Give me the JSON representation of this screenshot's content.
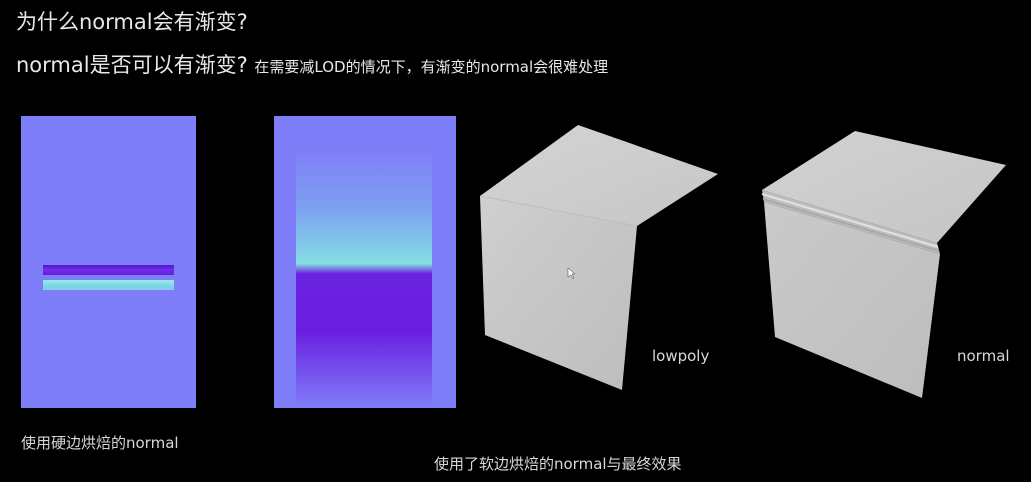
{
  "title_line1": "为什么normal会有渐变?",
  "title_line2_main": "normal是否可以有渐变?",
  "title_line2_sub": "在需要减LOD的情况下，有渐变的normal会很难处理",
  "caption_hard_edge": "使用硬边烘焙的normal",
  "caption_soft_edge": "使用了软边烘焙的normal与最终效果",
  "label_lowpoly": "lowpoly",
  "label_normal": "normal",
  "colors": {
    "normal_map_base": "#7f7ef9",
    "normal_map_purple": "#6a22e0",
    "normal_map_cyan": "#86e0e2",
    "surface_gray": "#c4c4c4"
  }
}
